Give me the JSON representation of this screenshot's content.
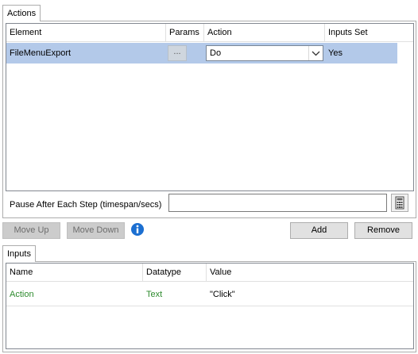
{
  "actions": {
    "tab_label": "Actions",
    "columns": [
      "Element",
      "Params",
      "Action",
      "Inputs Set"
    ],
    "rows": [
      {
        "element": "FileMenuExport",
        "params": "...",
        "action": "Do",
        "inputs_set": "Yes"
      }
    ]
  },
  "pause": {
    "label": "Pause After Each Step (timespan/secs)",
    "value": ""
  },
  "buttons": {
    "move_up": "Move Up",
    "move_down": "Move Down",
    "add": "Add",
    "remove": "Remove"
  },
  "inputs": {
    "tab_label": "Inputs",
    "columns": [
      "Name",
      "Datatype",
      "Value"
    ],
    "rows": [
      {
        "name": "Action",
        "datatype": "Text",
        "value": "\"Click\""
      }
    ]
  },
  "colors": {
    "selection": "#b3c9e9",
    "info": "#1c6fd1",
    "input_text": "#2e8b2e"
  },
  "icons": [
    "chevron-down-icon",
    "calculator-icon",
    "info-icon"
  ]
}
